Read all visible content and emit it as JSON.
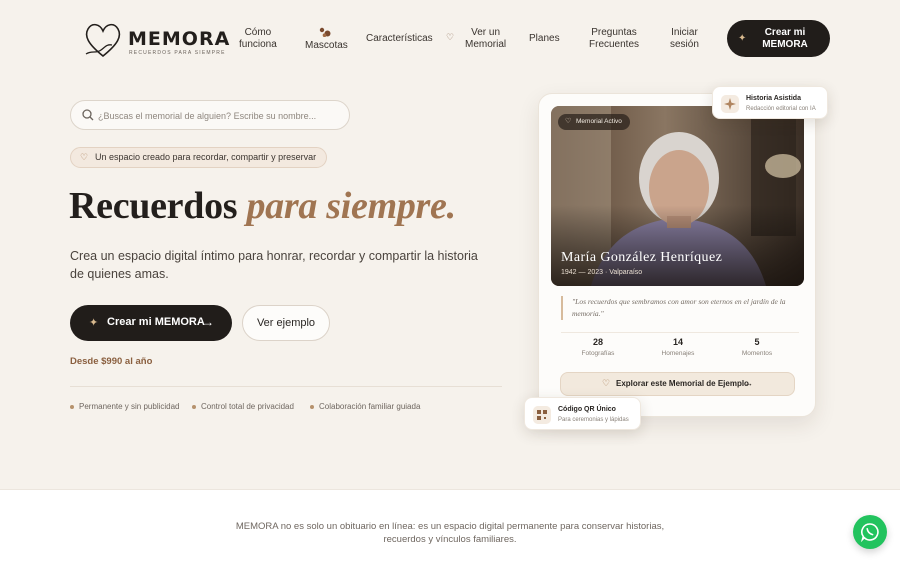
{
  "brand": {
    "name": "MEMORA",
    "tagline": "RECUERDOS PARA SIEMPRE"
  },
  "nav": {
    "items": [
      {
        "label": "Cómo\nfunciona",
        "icon": ""
      },
      {
        "label": "Mascotas",
        "icon": "paw-icon"
      },
      {
        "label": "Características",
        "icon": ""
      },
      {
        "label": "Ver un\nMemorial",
        "icon": "heart-icon"
      },
      {
        "label": "Planes",
        "icon": ""
      },
      {
        "label": "Preguntas\nFrecuentes",
        "icon": ""
      },
      {
        "label": "Iniciar\nsesión",
        "icon": ""
      }
    ],
    "cta": "Crear mi\nMEMORA"
  },
  "search": {
    "placeholder": "¿Buscas el memorial de alguien? Escribe su nombre..."
  },
  "hero": {
    "pill": "Un espacio creado para recordar, compartir y preservar",
    "headline_plain": "Recuerdos ",
    "headline_accent": "para siempre.",
    "lead": "Crea un espacio digital íntimo para honrar, recordar y compartir la historia de quienes amas.",
    "primary_cta": "Crear mi MEMORA",
    "secondary_cta": "Ver ejemplo",
    "price": "Desde $990 al año",
    "features": [
      "Permanente y sin publicidad",
      "Control total de privacidad",
      "Colaboración familiar guiada"
    ]
  },
  "memorial_card": {
    "badge": "Memorial Activo",
    "name": "María González Henríquez",
    "dates": "1942 — 2023 · Valparaíso",
    "quote": "\"Los recuerdos que sembramos con amor son eternos en el jardín de la memoria.\"",
    "stats": [
      {
        "value": "28",
        "label": "Fotografías"
      },
      {
        "value": "14",
        "label": "Homenajes"
      },
      {
        "value": "5",
        "label": "Momentos"
      }
    ],
    "explore": "Explorar este Memorial de Ejemplo"
  },
  "floats": {
    "top": {
      "title": "Historia Asistida",
      "subtitle": "Redacción editorial con IA"
    },
    "bottom": {
      "title": "Código QR Único",
      "subtitle": "Para ceremonias y lápidas"
    }
  },
  "footer": {
    "text": "MEMORA no es solo un obituario en línea: es un espacio digital permanente para conservar historias, recuerdos y vínculos familiares."
  },
  "colors": {
    "background": "#f6f2ec",
    "dark": "#211d1a",
    "accent": "#a07552",
    "whatsapp": "#22c35e"
  }
}
